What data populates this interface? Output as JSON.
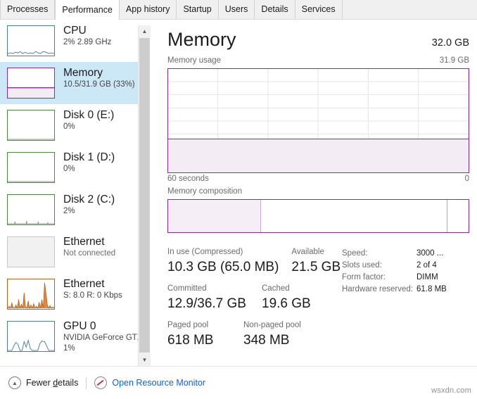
{
  "tabs": [
    {
      "label": "Processes",
      "active": false
    },
    {
      "label": "Performance",
      "active": true
    },
    {
      "label": "App history",
      "active": false
    },
    {
      "label": "Startup",
      "active": false
    },
    {
      "label": "Users",
      "active": false
    },
    {
      "label": "Details",
      "active": false
    },
    {
      "label": "Services",
      "active": false
    }
  ],
  "sidebar": {
    "items": [
      {
        "title": "CPU",
        "sub": "2% 2.89 GHz",
        "sub2": "",
        "color": "#4a7ea8",
        "selected": false,
        "graph": "cpu"
      },
      {
        "title": "Memory",
        "sub": "10.5/31.9 GB (33%)",
        "sub2": "",
        "color": "#8a2f8f",
        "selected": true,
        "graph": "memory"
      },
      {
        "title": "Disk 0 (E:)",
        "sub": "0%",
        "sub2": "",
        "color": "#4c8a3f",
        "selected": false,
        "graph": "flat"
      },
      {
        "title": "Disk 1 (D:)",
        "sub": "0%",
        "sub2": "",
        "color": "#4c8a3f",
        "selected": false,
        "graph": "flat"
      },
      {
        "title": "Disk 2 (C:)",
        "sub": "2%",
        "sub2": "",
        "color": "#4c8a3f",
        "selected": false,
        "graph": "disk2"
      },
      {
        "title": "Ethernet",
        "sub": "Not connected",
        "sub2": "",
        "color": "#c6c6c6",
        "selected": false,
        "graph": "none"
      },
      {
        "title": "Ethernet",
        "sub": "S: 8.0 R: 0 Kbps",
        "sub2": "",
        "color": "#b5651d",
        "selected": false,
        "graph": "net"
      },
      {
        "title": "GPU 0",
        "sub": "NVIDIA GeForce GTX",
        "sub2": "1%",
        "color": "#4a7ea8",
        "selected": false,
        "graph": "gpu"
      }
    ]
  },
  "header": {
    "title": "Memory",
    "total": "32.0 GB"
  },
  "usage": {
    "label": "Memory usage",
    "max": "31.9 GB",
    "axis_left": "60 seconds",
    "axis_right": "0",
    "fill_percent": 33
  },
  "composition": {
    "label": "Memory composition",
    "in_use_percent": 31,
    "modified_percent": 62,
    "free_percent": 7
  },
  "stats": {
    "row1": [
      {
        "label": "In use (Compressed)",
        "value": "10.3 GB (65.0 MB)"
      },
      {
        "label": "Available",
        "value": "21.5 GB"
      }
    ],
    "row2": [
      {
        "label": "Committed",
        "value": "12.9/36.7 GB"
      },
      {
        "label": "Cached",
        "value": "19.6 GB"
      }
    ],
    "row3": [
      {
        "label": "Paged pool",
        "value": "618 MB"
      },
      {
        "label": "Non-paged pool",
        "value": "348 MB"
      }
    ],
    "right": [
      {
        "key": "Speed:",
        "value": "3000 ..."
      },
      {
        "key": "Slots used:",
        "value": "2 of 4"
      },
      {
        "key": "Form factor:",
        "value": "DIMM"
      },
      {
        "key": "Hardware reserved:",
        "value": "61.8 MB"
      }
    ]
  },
  "footer": {
    "fewer_pre": "Fewer ",
    "fewer_underlined": "d",
    "fewer_post": "etails",
    "resource_monitor": "Open Resource Monitor",
    "watermark": "wsxdn.com"
  },
  "colors": {
    "accent_purple": "#8a2f8f",
    "selection_blue": "#cce8f6",
    "link_blue": "#0b63ce"
  }
}
